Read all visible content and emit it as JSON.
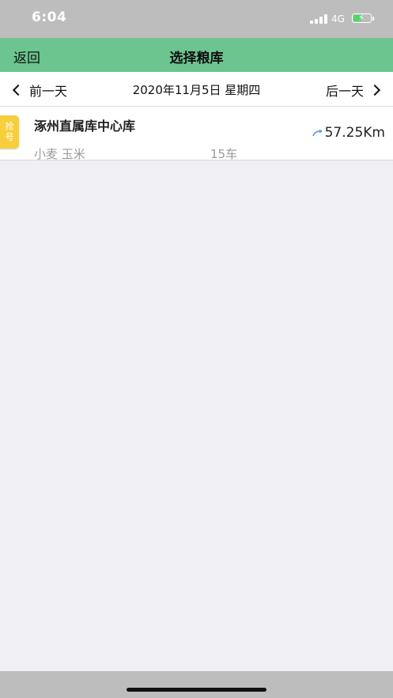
{
  "status_bar": {
    "time": "6:04",
    "network": "4G",
    "battery_level": 0.5,
    "battery_color": "#4cd964"
  },
  "nav": {
    "back_label": "返回",
    "title": "选择粮库",
    "color": "#6cc48f"
  },
  "date_bar": {
    "prev_label": "前一天",
    "current": "2020年11月5日 星期四",
    "next_label": "后一天"
  },
  "depots": [
    {
      "badge": [
        "抢",
        "号"
      ],
      "name": "涿州直属库中心库",
      "distance": "57.25Km",
      "grains": "小麦 玉米",
      "cars": "15车"
    }
  ],
  "icons": {
    "back": "chevron-left-icon",
    "next": "chevron-right-icon",
    "distance": "route-icon"
  }
}
